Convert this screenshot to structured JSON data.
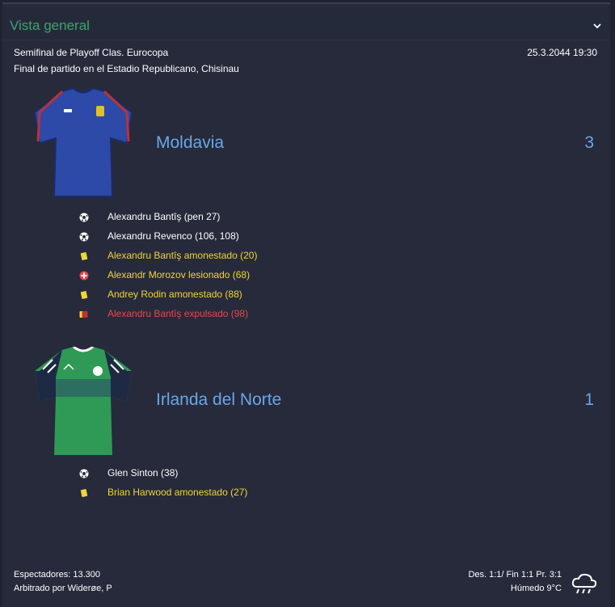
{
  "panel": {
    "title": "Vista general"
  },
  "match": {
    "competition": "Semifinal de Playoff Clas. Eurocopa",
    "venue": "Final de partido en el Estadio Republicano, Chisinau",
    "datetime": "25.3.2044 19:30"
  },
  "home": {
    "name": "Moldavia",
    "score": "3",
    "shirt": {
      "main": "#2e4aa8",
      "trim": "#c0302e",
      "collar": "#1c2c6a"
    },
    "events": [
      {
        "type": "goal",
        "icon": "ball-icon",
        "text": "Alexandru Bantîş (pen 27)",
        "color": "white"
      },
      {
        "type": "goal",
        "icon": "ball-icon",
        "text": "Alexandru Revenco (106, 108)",
        "color": "white"
      },
      {
        "type": "yellow",
        "icon": "yellow-card-icon",
        "text": "Alexandru Bantîş amonestado (20)",
        "color": "yellow"
      },
      {
        "type": "injury",
        "icon": "injury-icon",
        "text": "Alexandr Morozov lesionado (68)",
        "color": "yellow"
      },
      {
        "type": "yellow",
        "icon": "yellow-card-icon",
        "text": "Andrey Rodin amonestado (88)",
        "color": "yellow"
      },
      {
        "type": "red",
        "icon": "second-yellow-red-card-icon",
        "text": "Alexandru Bantîş expulsado (98)",
        "color": "red"
      }
    ]
  },
  "away": {
    "name": "Irlanda del Norte",
    "score": "1",
    "shirt": {
      "main": "#2f9a55",
      "trim": "#ffffff",
      "collar": "#1e2a44"
    },
    "events": [
      {
        "type": "goal",
        "icon": "ball-icon",
        "text": "Glen Sinton (38)",
        "color": "white"
      },
      {
        "type": "yellow",
        "icon": "yellow-card-icon",
        "text": "Brian Harwood amonestado (27)",
        "color": "yellow"
      }
    ]
  },
  "footer": {
    "attendance": "Espectadores: 13.300",
    "referee": "Arbitrado por Widerøe, P",
    "score_details": "Des. 1:1/ Fin 1:1 Pr. 3:1",
    "weather": "Húmedo 9°C",
    "weather_icon": "rain-cloud-icon"
  }
}
